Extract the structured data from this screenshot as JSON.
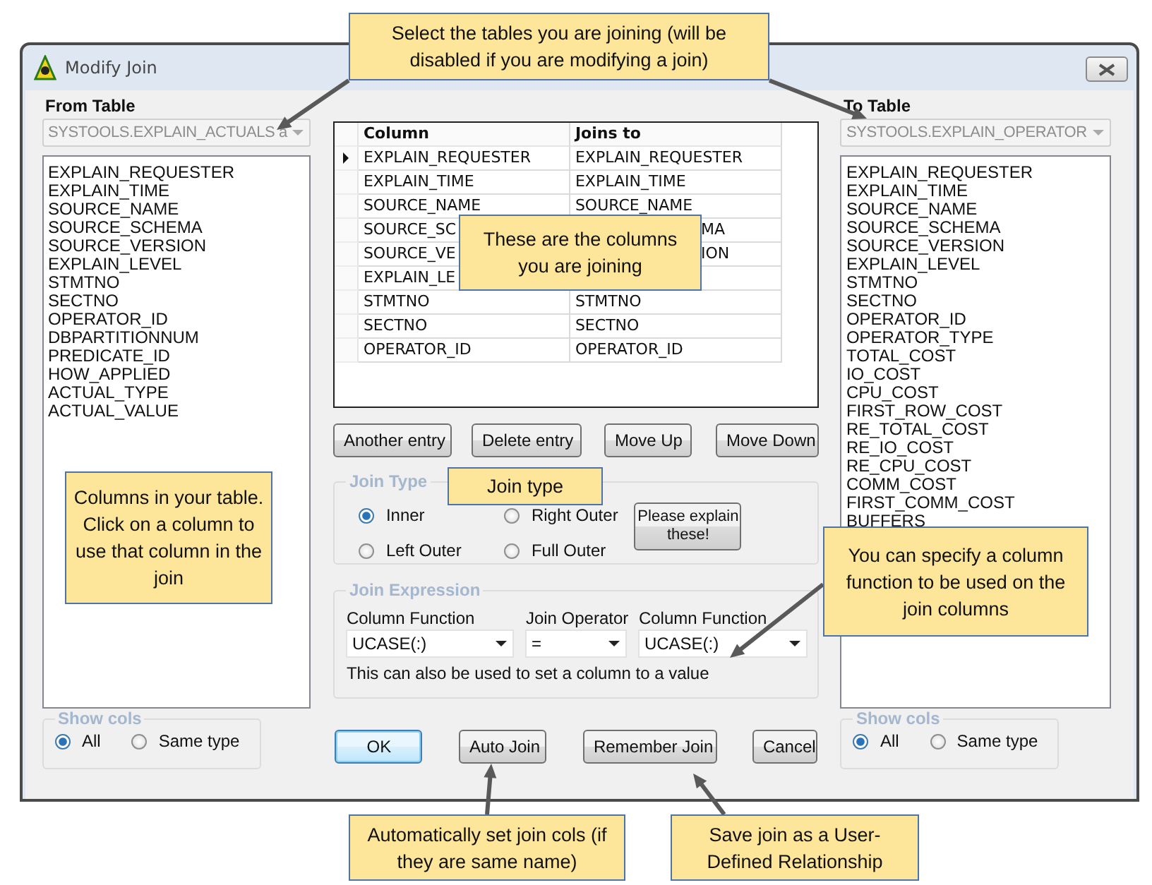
{
  "window": {
    "title": "Modify Join"
  },
  "from_table": {
    "label": "From Table",
    "value": "SYSTOOLS.EXPLAIN_ACTUALS a",
    "disabled": true,
    "columns": [
      "EXPLAIN_REQUESTER",
      "EXPLAIN_TIME",
      "SOURCE_NAME",
      "SOURCE_SCHEMA",
      "SOURCE_VERSION",
      "EXPLAIN_LEVEL",
      "STMTNO",
      "SECTNO",
      "OPERATOR_ID",
      "DBPARTITIONNUM",
      "PREDICATE_ID",
      "HOW_APPLIED",
      "ACTUAL_TYPE",
      "ACTUAL_VALUE"
    ],
    "show_cols": {
      "title": "Show cols",
      "options": [
        {
          "label": "All",
          "selected": true
        },
        {
          "label": "Same type",
          "selected": false
        }
      ]
    }
  },
  "grid": {
    "columns": [
      "Column",
      "Joins to"
    ],
    "rows": [
      {
        "cells": [
          "EXPLAIN_REQUESTER",
          "EXPLAIN_REQUESTER"
        ],
        "current": true,
        "partly_hidden": false
      },
      {
        "cells": [
          "EXPLAIN_TIME",
          "EXPLAIN_TIME"
        ],
        "current": false,
        "partly_hidden": false
      },
      {
        "cells": [
          "SOURCE_NAME",
          "SOURCE_NAME"
        ],
        "current": false,
        "partly_hidden": false
      },
      {
        "cells": [
          "SOURCE_SC",
          "MA"
        ],
        "current": false,
        "partly_hidden": true
      },
      {
        "cells": [
          "SOURCE_VE",
          "ION"
        ],
        "current": false,
        "partly_hidden": true
      },
      {
        "cells": [
          "EXPLAIN_LE"
        ],
        "current": false,
        "partly_hidden": true
      },
      {
        "cells": [
          "STMTNO",
          "STMTNO"
        ],
        "current": false,
        "partly_hidden": false
      },
      {
        "cells": [
          "SECTNO",
          "SECTNO"
        ],
        "current": false,
        "partly_hidden": false
      },
      {
        "cells": [
          "OPERATOR_ID",
          "OPERATOR_ID"
        ],
        "current": false,
        "partly_hidden": false
      }
    ]
  },
  "grid_buttons": [
    "Another entry",
    "Delete entry",
    "Move Up",
    "Move Down"
  ],
  "join_type": {
    "title": "Join Type",
    "options": [
      {
        "label": "Inner",
        "selected": true
      },
      {
        "label": "Right Outer",
        "selected": false
      },
      {
        "label": "Left Outer",
        "selected": false
      },
      {
        "label": "Full Outer",
        "selected": false
      }
    ],
    "help_button": "Please explain these!"
  },
  "join_expression": {
    "title": "Join Expression",
    "fields": [
      {
        "label": "Column Function",
        "value": "UCASE(:)"
      },
      {
        "label": "Join Operator",
        "value": "="
      },
      {
        "label": "Column Function",
        "value": "UCASE(:)"
      }
    ],
    "note": "This can also be used to set a column to a value"
  },
  "buttons": [
    {
      "label": "OK",
      "default": true
    },
    {
      "label": "Auto Join",
      "default": false
    },
    {
      "label": "Remember Join",
      "default": false
    },
    {
      "label": "Cancel",
      "default": false
    }
  ],
  "to_table": {
    "label": "To Table",
    "value": "SYSTOOLS.EXPLAIN_OPERATOR",
    "disabled": true,
    "columns": [
      "EXPLAIN_REQUESTER",
      "EXPLAIN_TIME",
      "SOURCE_NAME",
      "SOURCE_SCHEMA",
      "SOURCE_VERSION",
      "EXPLAIN_LEVEL",
      "STMTNO",
      "SECTNO",
      "OPERATOR_ID",
      "OPERATOR_TYPE",
      "TOTAL_COST",
      "IO_COST",
      "CPU_COST",
      "FIRST_ROW_COST",
      "RE_TOTAL_COST",
      "RE_IO_COST",
      "RE_CPU_COST",
      "COMM_COST",
      "FIRST_COMM_COST",
      "BUFFERS"
    ],
    "show_cols": {
      "title": "Show cols",
      "options": [
        {
          "label": "All",
          "selected": true
        },
        {
          "label": "Same type",
          "selected": false
        }
      ]
    }
  },
  "callouts": [
    {
      "text": "Select the tables you are joining (will be disabled if you are modifying a join)"
    },
    {
      "text": "These are the columns you are joining"
    },
    {
      "text": "Columns in your table. Click on a column to use that column in the join"
    },
    {
      "text": "Join type"
    },
    {
      "text": "You can specify a column function to be used on the join columns"
    },
    {
      "text": "Automatically set join cols (if they are same name)"
    },
    {
      "text": "Save join as a User-Defined Relationship"
    }
  ]
}
